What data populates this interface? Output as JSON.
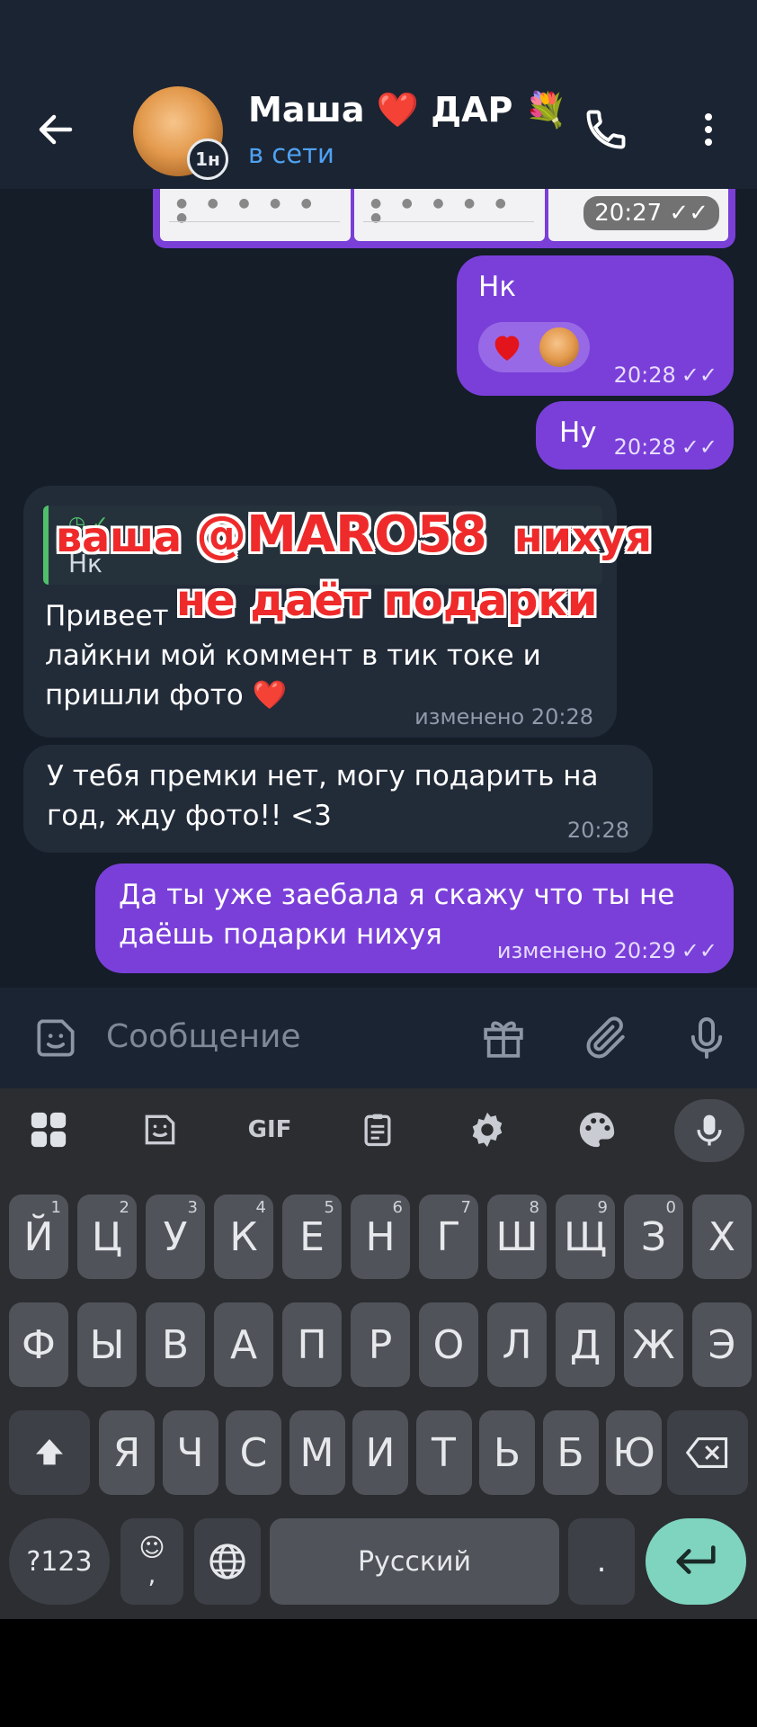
{
  "header": {
    "title": "Маша ❤️ ДАР 💐",
    "status": "в сети",
    "story_badge": "1н"
  },
  "top_strip": {
    "time": "20:27 ✓✓"
  },
  "messages": [
    {
      "text": "Нк",
      "time": "20:28",
      "reactions": [
        "❤️",
        "cat-avatar"
      ]
    },
    {
      "text": "Ну",
      "time": "20:28"
    },
    {
      "reply_text": "Нк",
      "text": "Привеет... лайкни мой коммент в тик токе и пришли фото ❤️",
      "line1": "Привеет",
      "line2": "лайкни мой коммент в тик токе и",
      "line3": "пришли фото",
      "heart": "❤️",
      "meta": "изменено 20:28"
    },
    {
      "line1": "У тебя премки нет, могу подарить на",
      "line2": "год, жду фото!! <3",
      "time": "20:28"
    },
    {
      "line1": "Да ты уже заебала я скажу что ты не",
      "line2": "даёшь подарки нихуя",
      "meta": "изменено 20:29"
    }
  ],
  "overlay": {
    "line1_a": "ваша",
    "line1_b": "@MARO58",
    "line1_c": "нихуя",
    "line2": "не даёт подарки"
  },
  "input": {
    "placeholder": "Сообщение"
  },
  "keyboard": {
    "toolbar": [
      "apps-icon",
      "sticker-icon",
      "GIF",
      "clipboard-icon",
      "gear-icon",
      "palette-icon",
      "mic-icon"
    ],
    "gif_label": "GIF",
    "row1": [
      {
        "k": "Й",
        "h": "1"
      },
      {
        "k": "Ц",
        "h": "2"
      },
      {
        "k": "У",
        "h": "3"
      },
      {
        "k": "К",
        "h": "4"
      },
      {
        "k": "Е",
        "h": "5"
      },
      {
        "k": "Н",
        "h": "6"
      },
      {
        "k": "Г",
        "h": "7"
      },
      {
        "k": "Ш",
        "h": "8"
      },
      {
        "k": "Щ",
        "h": "9"
      },
      {
        "k": "З",
        "h": "0"
      },
      {
        "k": "Х",
        "h": ""
      }
    ],
    "row2": [
      "Ф",
      "Ы",
      "В",
      "А",
      "П",
      "Р",
      "О",
      "Л",
      "Д",
      "Ж",
      "Э"
    ],
    "row3": [
      "Я",
      "Ч",
      "С",
      "М",
      "И",
      "Т",
      "Ь",
      "Б",
      "Ю"
    ],
    "sym_label": "?123",
    "emoji_label": "☺",
    "comma_label": ",",
    "space_label": "Русский",
    "period_label": "."
  },
  "colors": {
    "outgoing": "#7a3fd9",
    "incoming": "#222b38",
    "accent": "#4ea2f2",
    "enter": "#7fd4c0"
  }
}
